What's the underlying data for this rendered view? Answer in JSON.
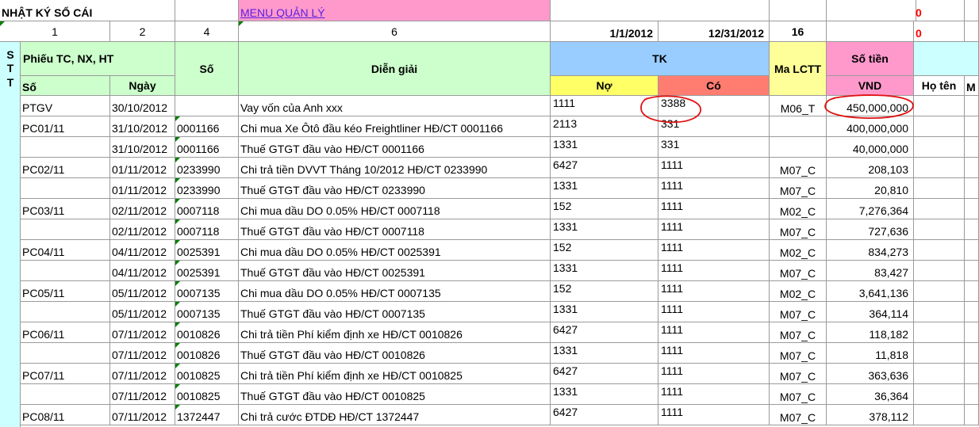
{
  "row1": {
    "title": "NHẬT KÝ SỔ CÁI",
    "menu_link": "MENU QUẢN LÝ",
    "flag": "0"
  },
  "row2": {
    "col_a": "1",
    "col_b": "2",
    "col_c": "4",
    "col_d": "6",
    "date_from": "1/1/2012",
    "date_to": "12/31/2012",
    "count": "16",
    "flag": "0"
  },
  "header": {
    "stt": [
      "S",
      "T",
      "T"
    ],
    "phieu": "Phiếu TC, NX, HT",
    "so_phieu": "Số",
    "ngay": "Ngày",
    "so": "Số",
    "dien_giai": "Diễn giải",
    "tk": "TK",
    "no": "Nợ",
    "co": "Có",
    "ma_lctt": "Ma LCTT",
    "so_tien": "Số tiền",
    "vnd": "VND",
    "ho_ten": "Họ tên",
    "extra": "M"
  },
  "rows": [
    [
      "PTGV",
      "30/10/2012",
      "",
      "Vay vốn của Anh xxx",
      "1111",
      "3388",
      "M06_T",
      "450,000,000"
    ],
    [
      "PC01/11",
      "31/10/2012",
      "0001166",
      "Chi mua Xe Ôtô đầu kéo Freightliner HĐ/CT 0001166",
      "2113",
      "331",
      "",
      "400,000,000"
    ],
    [
      "",
      "31/10/2012",
      "0001166",
      "Thuế GTGT đầu vào HĐ/CT 0001166",
      "1331",
      "331",
      "",
      "40,000,000"
    ],
    [
      "PC02/11",
      "01/11/2012",
      "0233990",
      "Chi trả tiền DVVT Tháng 10/2012 HĐ/CT 0233990",
      "6427",
      "1111",
      "M07_C",
      "208,103"
    ],
    [
      "",
      "01/11/2012",
      "0233990",
      "Thuế GTGT đầu vào HĐ/CT 0233990",
      "1331",
      "1111",
      "M07_C",
      "20,810"
    ],
    [
      "PC03/11",
      "02/11/2012",
      "0007118",
      "Chi mua dầu DO 0.05% HĐ/CT 0007118",
      "152",
      "1111",
      "M02_C",
      "7,276,364"
    ],
    [
      "",
      "02/11/2012",
      "0007118",
      "Thuế GTGT đầu vào HĐ/CT 0007118",
      "1331",
      "1111",
      "M07_C",
      "727,636"
    ],
    [
      "PC04/11",
      "04/11/2012",
      "0025391",
      "Chi mua dầu DO 0.05% HĐ/CT 0025391",
      "152",
      "1111",
      "M02_C",
      "834,273"
    ],
    [
      "",
      "04/11/2012",
      "0025391",
      "Thuế GTGT đầu vào HĐ/CT 0025391",
      "1331",
      "1111",
      "M07_C",
      "83,427"
    ],
    [
      "PC05/11",
      "05/11/2012",
      "0007135",
      "Chi mua dầu DO 0.05% HĐ/CT 0007135",
      "152",
      "1111",
      "M02_C",
      "3,641,136"
    ],
    [
      "",
      "05/11/2012",
      "0007135",
      "Thuế GTGT đầu vào HĐ/CT 0007135",
      "1331",
      "1111",
      "M07_C",
      "364,114"
    ],
    [
      "PC06/11",
      "07/11/2012",
      "0010826",
      "Chi trả tiền Phí kiểm định xe HĐ/CT 0010826",
      "6427",
      "1111",
      "M07_C",
      "118,182"
    ],
    [
      "",
      "07/11/2012",
      "0010826",
      "Thuế GTGT đầu vào HĐ/CT 0010826",
      "1331",
      "1111",
      "M07_C",
      "11,818"
    ],
    [
      "PC07/11",
      "07/11/2012",
      "0010825",
      "Chi trả tiền Phí kiểm định xe HĐ/CT 0010825",
      "6427",
      "1111",
      "M07_C",
      "363,636"
    ],
    [
      "",
      "07/11/2012",
      "0010825",
      "Thuế GTGT đầu vào HĐ/CT 0010825",
      "1331",
      "1111",
      "M07_C",
      "36,364"
    ],
    [
      "PC08/11",
      "07/11/2012",
      "1372447",
      "Chi trả cước ĐTDĐ  HĐ/CT 1372447",
      "6427",
      "1111",
      "M07_C",
      "378,112"
    ]
  ],
  "colors": {
    "header_green": "#ccffcc",
    "header_blue": "#99ccff",
    "debit_yellow": "#ffff66",
    "credit_red": "#ff7c70",
    "amount_pink": "#ff99cc",
    "annotation_red": "#e01010"
  }
}
